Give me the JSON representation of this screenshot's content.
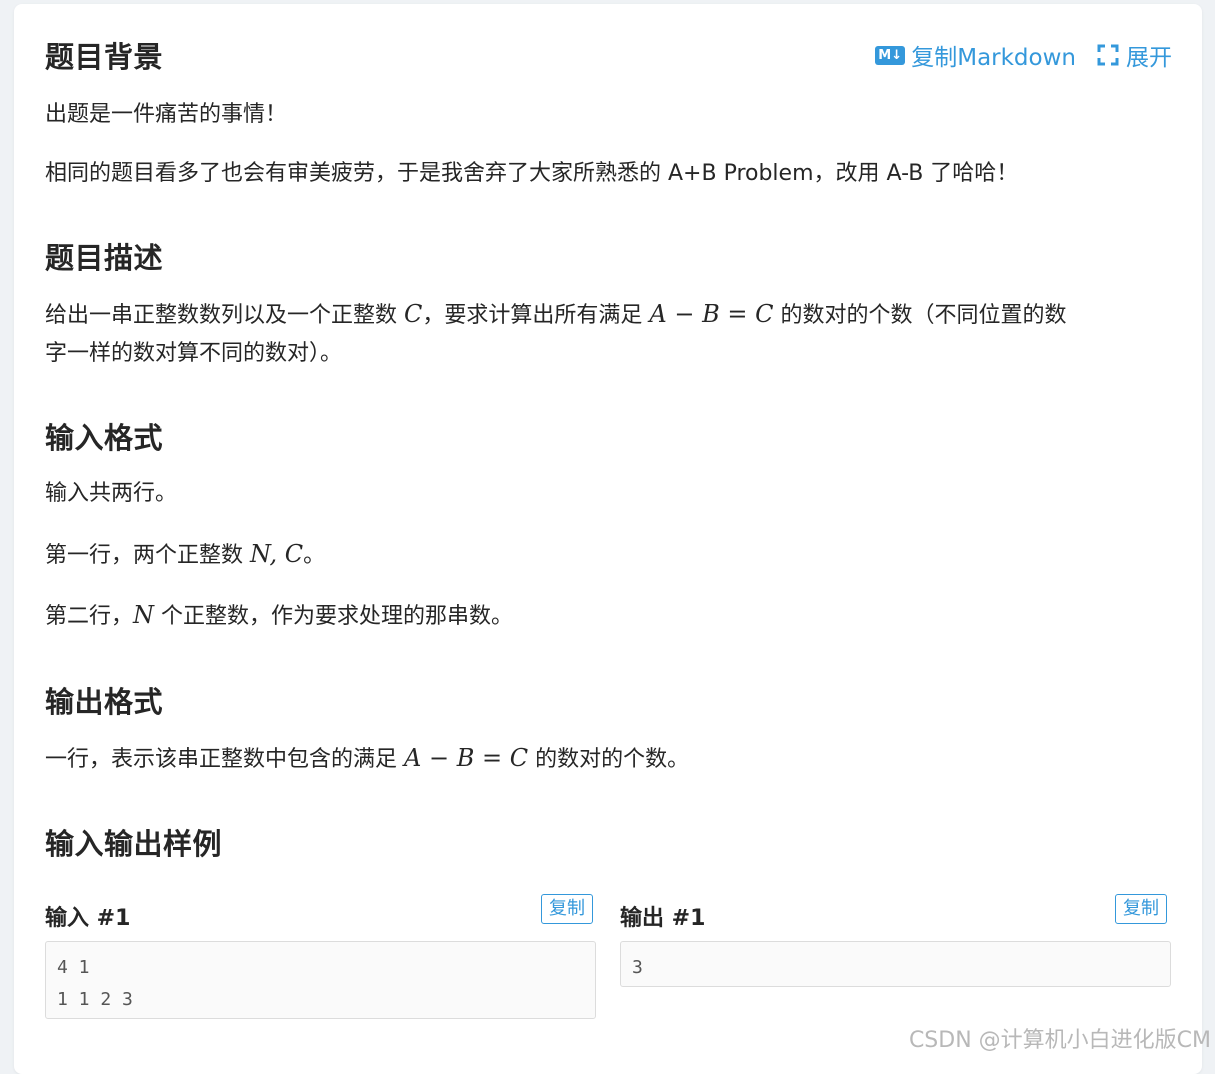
{
  "actions": {
    "markdown_icon": "M↓",
    "copy_markdown": "复制Markdown",
    "expand": "展开"
  },
  "background": {
    "title": "题目背景",
    "p1": "出题是一件痛苦的事情！",
    "p2": "相同的题目看多了也会有审美疲劳，于是我舍弃了大家所熟悉的 A+B Problem，改用 A-B 了哈哈！"
  },
  "description": {
    "title": "题目描述",
    "line1_a": "给出一串正整数数列以及一个正整数 ",
    "var_c": "C",
    "line1_b": "，要求计算出所有满足 ",
    "eq_a": "A",
    "eq_minus": " − ",
    "eq_b": "B",
    "eq_eq": " = ",
    "eq_c": "C",
    "line1_c": " 的数对的个数（不同位置的数",
    "line2": "字一样的数对算不同的数对）。"
  },
  "input_format": {
    "title": "输入格式",
    "p1": "输入共两行。",
    "p2_a": "第一行，两个正整数 ",
    "p2_vars": "N, C",
    "p2_b": "。",
    "p3_a": "第二行，",
    "p3_var": "N",
    "p3_b": " 个正整数，作为要求处理的那串数。"
  },
  "output_format": {
    "title": "输出格式",
    "p1_a": "一行，表示该串正整数中包含的满足 ",
    "eq_a": "A",
    "eq_minus": " − ",
    "eq_b": "B",
    "eq_eq": " = ",
    "eq_c": "C",
    "p1_b": " 的数对的个数。"
  },
  "samples": {
    "title": "输入输出样例",
    "input_label": "输入 #1",
    "output_label": "输出 #1",
    "copy_label": "复制",
    "input_text": "4 1\n1 1 2 3",
    "output_text": "3"
  },
  "watermark": "CSDN @计算机小白进化版CM",
  "colors": {
    "accent": "#3498db",
    "text": "#262626",
    "page_bg": "#eff2f5"
  }
}
